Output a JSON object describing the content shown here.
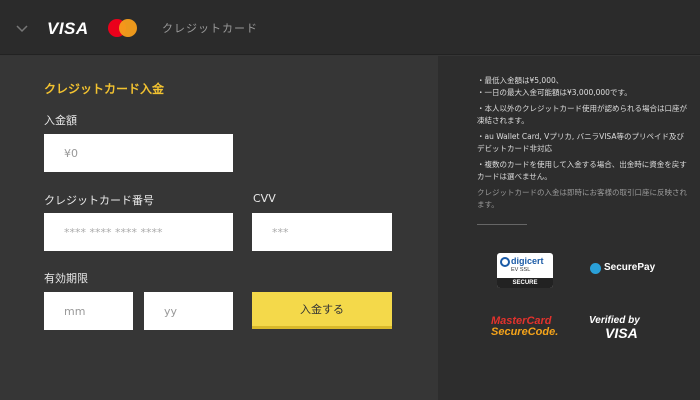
{
  "header": {
    "visa_label": "VISA",
    "label": "クレジットカード"
  },
  "form": {
    "section_title": "クレジットカード入金",
    "amount_label": "入金額",
    "amount_placeholder": "¥0",
    "card_number_label": "クレジットカード番号",
    "card_number_placeholder": "**** **** **** ****",
    "cvv_label": "CVV",
    "cvv_placeholder": "***",
    "expiry_label": "有効期限",
    "month_placeholder": "mm",
    "year_placeholder": "yy",
    "submit_label": "入金する"
  },
  "notes": [
    "・最低入金額は¥5,000、",
    "・一日の最大入金可能額は¥3,000,000です。",
    "・本人以外のクレジットカード使用が認められる場合は口座が凍結されます。",
    "・au Wallet Card, Vプリカ, バニラVISA等のプリペイド及びデビットカード非対応",
    "・複数のカードを使用して入金する場合、出金時に資金を戻すカードは選べません。"
  ],
  "notes_muted": "クレジットカードの入金は即時にお客様の取引口座に反映されます。",
  "badges": {
    "digicert_title": "digicert",
    "digicert_sub": "EV SSL",
    "digicert_secure": "SECURE",
    "securepay": "SecurePay",
    "mastercard_line1": "MasterCard",
    "mastercard_line2": "SecureCode.",
    "vbv_line1": "Verified by",
    "vbv_line2": "VISA"
  },
  "colors": {
    "accent_yellow": "#f2c230",
    "button_yellow": "#f4d94a",
    "background": "#353535"
  }
}
